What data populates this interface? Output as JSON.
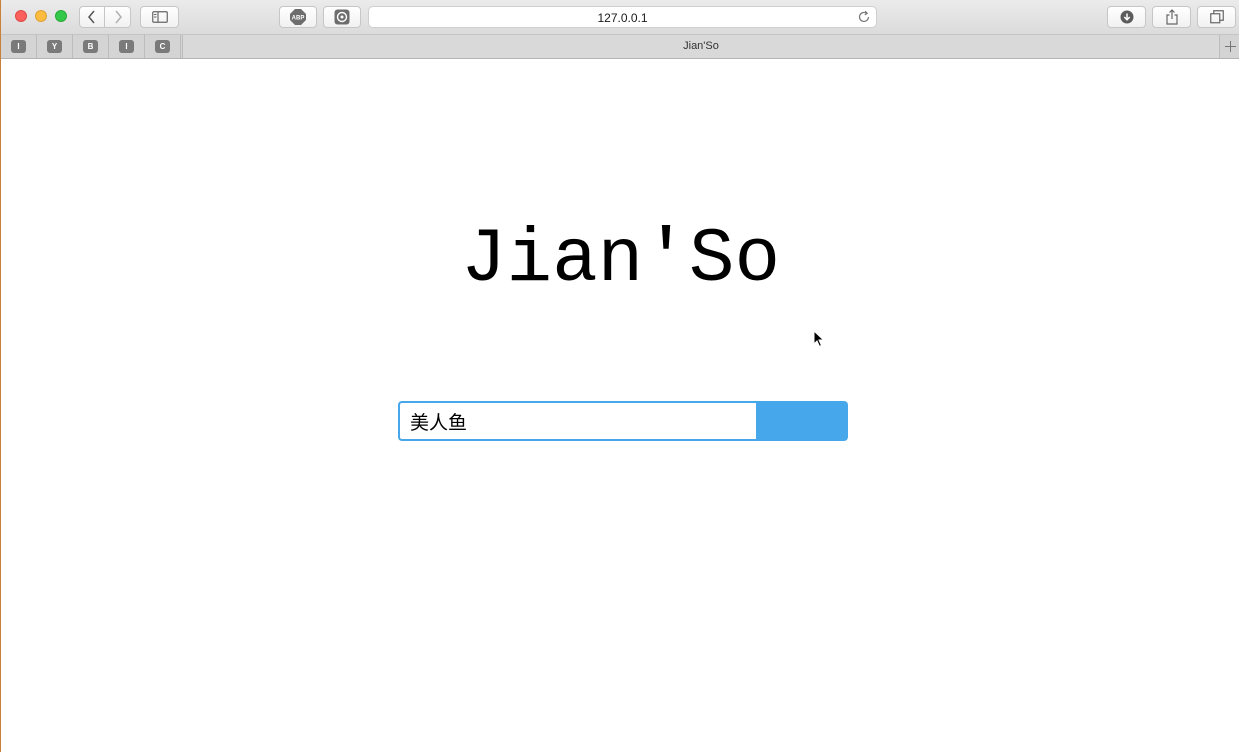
{
  "browser": {
    "url": "127.0.0.1",
    "tab_title": "Jian'So",
    "adblock_label": "ABP",
    "pinned_tabs": [
      "I",
      "Y",
      "B",
      "I",
      "C"
    ],
    "icons": [
      "back-icon",
      "forward-icon",
      "sidebar-icon",
      "adblock-icon",
      "extension-icon",
      "reload-icon",
      "download-icon",
      "share-icon",
      "tabs-overview-icon",
      "new-tab-icon"
    ]
  },
  "page": {
    "logo": "Jian'So",
    "search": {
      "value": "美人鱼",
      "button_label": ""
    }
  },
  "colors": {
    "accent": "#46a7ea",
    "page_background": "#ffffff"
  }
}
